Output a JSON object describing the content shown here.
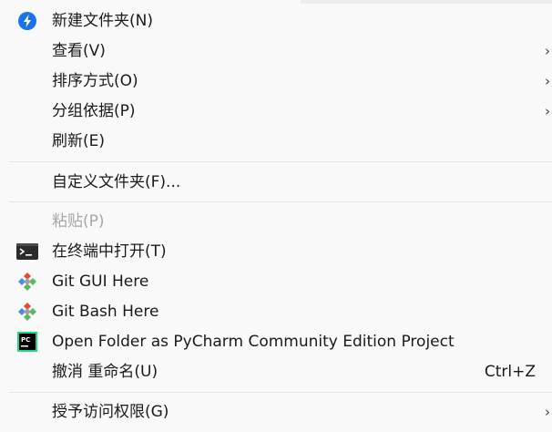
{
  "menu": {
    "items": [
      {
        "label": "新建文件夹(N)",
        "icon": "new-folder-icon"
      },
      {
        "label": "查看(V)",
        "submenu": "›"
      },
      {
        "label": "排序方式(O)",
        "submenu": "›"
      },
      {
        "label": "分组依据(P)",
        "submenu": "›"
      },
      {
        "label": "刷新(E)"
      },
      {
        "label": "自定义文件夹(F)..."
      },
      {
        "label": "粘贴(P)",
        "disabled": true
      },
      {
        "label": "在终端中打开(T)",
        "icon": "terminal-icon"
      },
      {
        "label": "Git GUI Here",
        "icon": "git-icon"
      },
      {
        "label": "Git Bash Here",
        "icon": "git-icon"
      },
      {
        "label": "Open Folder as PyCharm Community Edition Project",
        "icon": "pycharm-icon",
        "icon_text": "PC"
      },
      {
        "label": "撤消 重命名(U)",
        "shortcut": "Ctrl+Z"
      },
      {
        "label": "授予访问权限(G)",
        "submenu": "›"
      }
    ]
  },
  "colors": {
    "menu_bg": "#f9f9f9",
    "separator": "#e3e3e3",
    "disabled_text": "#a6a6a6",
    "new_folder_icon": "#1a73e8",
    "git_red": "#e64a2e",
    "git_green": "#5cb85c",
    "git_blue": "#4a90e2",
    "pycharm_green": "#21d789"
  }
}
